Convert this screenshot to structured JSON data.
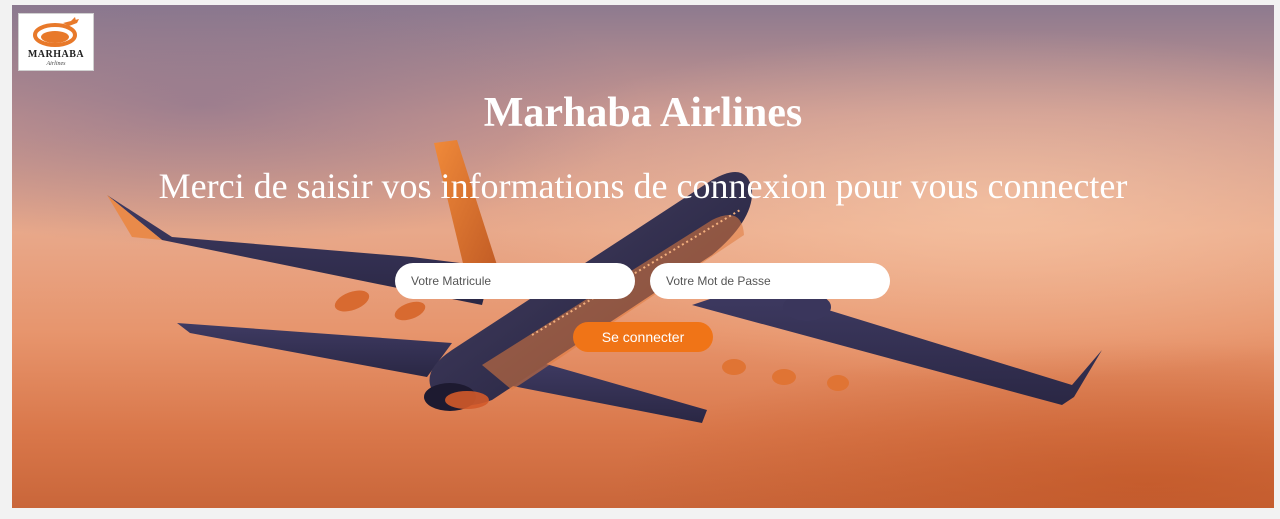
{
  "app": {
    "title": "Marhaba Airlines",
    "instructions": "Merci de saisir vos informations de connexion pour vous connecter"
  },
  "logo": {
    "name": "MARHABA",
    "tagline": "Airlines",
    "icon": "airplane-swoosh-icon",
    "color": "#e8792a"
  },
  "background": {
    "image": "airplane-in-sunset-sky",
    "sky_color": "#e8a88a",
    "plane_color": "#3d3a5c"
  },
  "form": {
    "matricule": {
      "placeholder": "Votre Matricule",
      "value": ""
    },
    "password": {
      "placeholder": "Votre Mot de Passe",
      "value": ""
    },
    "submit_label": "Se connecter",
    "accent": "#f07417"
  }
}
